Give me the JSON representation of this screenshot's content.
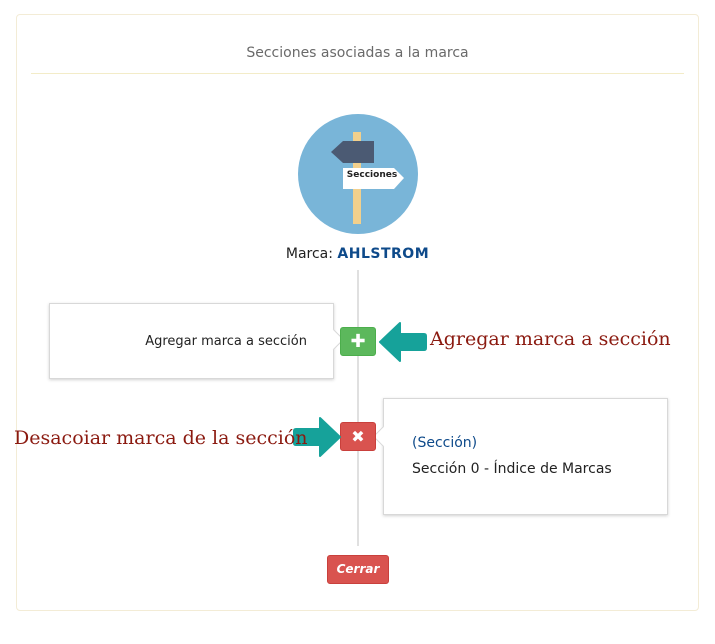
{
  "dialog": {
    "title": "Secciones asociadas a la marca",
    "emblem_label": "Secciones",
    "brand_prefix": "Marca:",
    "brand_name": "AHLSTROM",
    "close_label": "Cerrar"
  },
  "add_card": {
    "text": "Agregar marca a sección"
  },
  "section_card": {
    "link_label": "(Sección)",
    "section_name": "Sección 0 - Índice de Marcas"
  },
  "annotations": {
    "add": "Agregar marca a sección",
    "remove": "Desacoiar marca de la sección"
  },
  "icons": {
    "add": "plus-icon",
    "remove": "x-icon",
    "arrow": "arrow-icon",
    "emblem": "signpost-icon"
  },
  "colors": {
    "success": "#5cb85c",
    "danger": "#d9534f",
    "arrow": "#16a29a",
    "annotation": "#8b1a10",
    "emblem_bg": "#79b5d8",
    "brand": "#0e4a8a"
  }
}
